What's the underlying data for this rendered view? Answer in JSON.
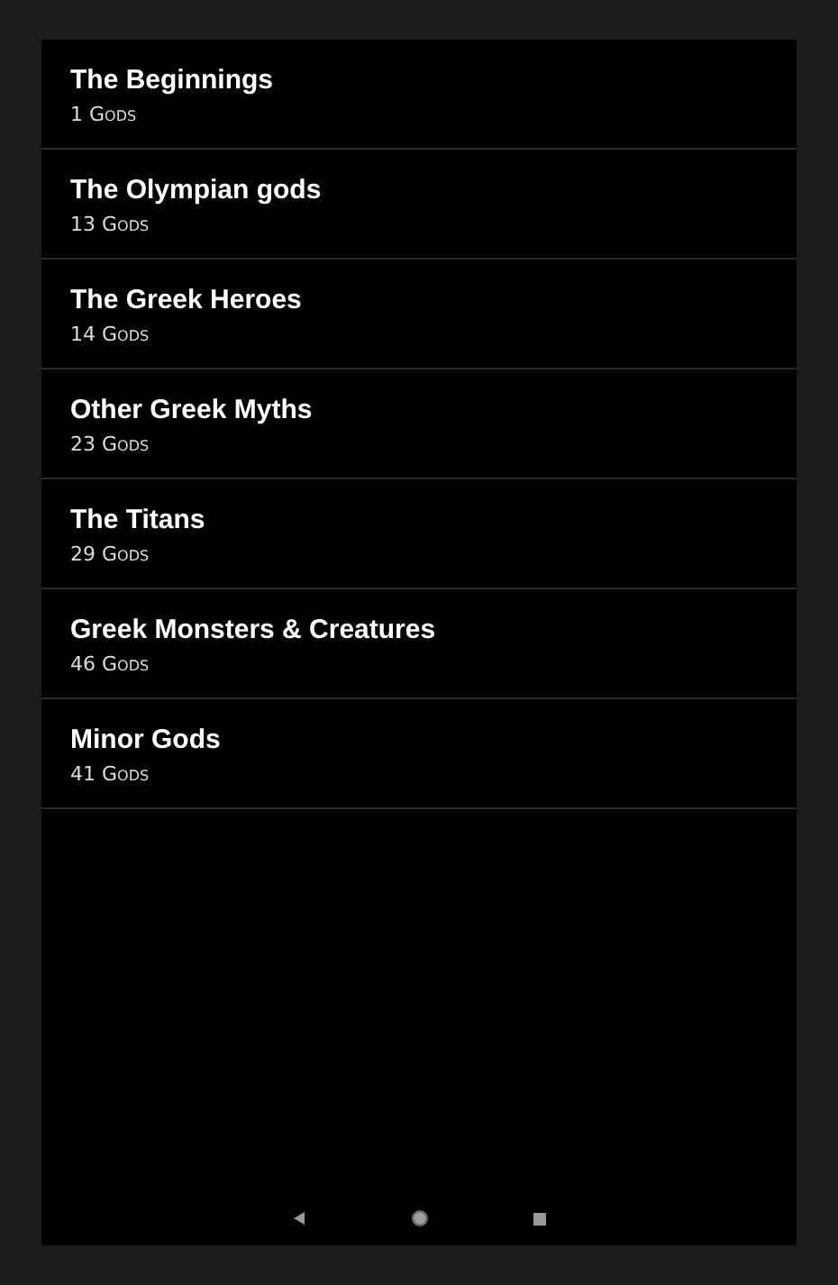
{
  "categories": [
    {
      "title": "The Beginnings",
      "count": "1 Gods"
    },
    {
      "title": "The Olympian gods",
      "count": "13 Gods"
    },
    {
      "title": "The Greek Heroes",
      "count": "14 Gods"
    },
    {
      "title": "Other Greek Myths",
      "count": "23 Gods"
    },
    {
      "title": "The Titans",
      "count": "29 Gods"
    },
    {
      "title": "Greek Monsters & Creatures",
      "count": "46 Gods"
    },
    {
      "title": "Minor Gods",
      "count": "41 Gods"
    }
  ]
}
